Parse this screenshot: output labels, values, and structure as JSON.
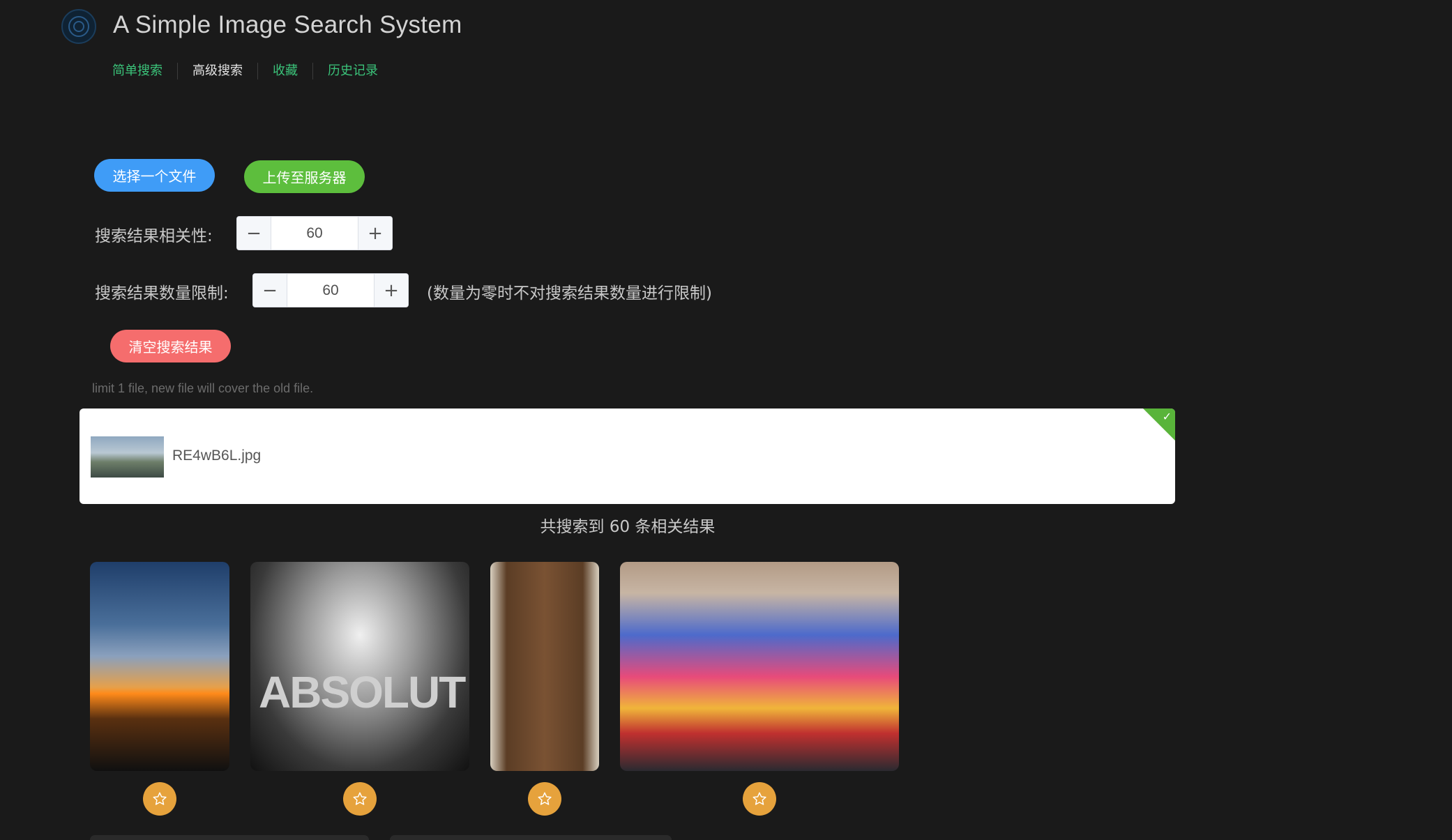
{
  "app": {
    "title": "A Simple Image Search System"
  },
  "nav": {
    "items": [
      {
        "label": "简单搜索"
      },
      {
        "label": "高级搜索"
      },
      {
        "label": "收藏"
      },
      {
        "label": "历史记录"
      }
    ]
  },
  "actions": {
    "choose_file": "选择一个文件",
    "upload": "上传至服务器",
    "clear": "清空搜索结果"
  },
  "form": {
    "relevance": {
      "label": "搜索结果相关性:",
      "value": "60"
    },
    "limit": {
      "label": "搜索结果数量限制:",
      "value": "60",
      "note": "(数量为零时不对搜索结果数量进行限制)"
    }
  },
  "upload": {
    "tip": "limit 1 file, new file will cover the old file.",
    "file_name": "RE4wB6L.jpg",
    "status": "success"
  },
  "results": {
    "summary": "共搜索到 60 条相关结果"
  },
  "colors": {
    "background": "#1a1a1a",
    "accent_green": "#3bc47a",
    "primary_blue": "#3f9cf7",
    "success_green": "#5dbe3d",
    "danger_red": "#f56d6d",
    "warning_orange": "#e6a23c"
  }
}
